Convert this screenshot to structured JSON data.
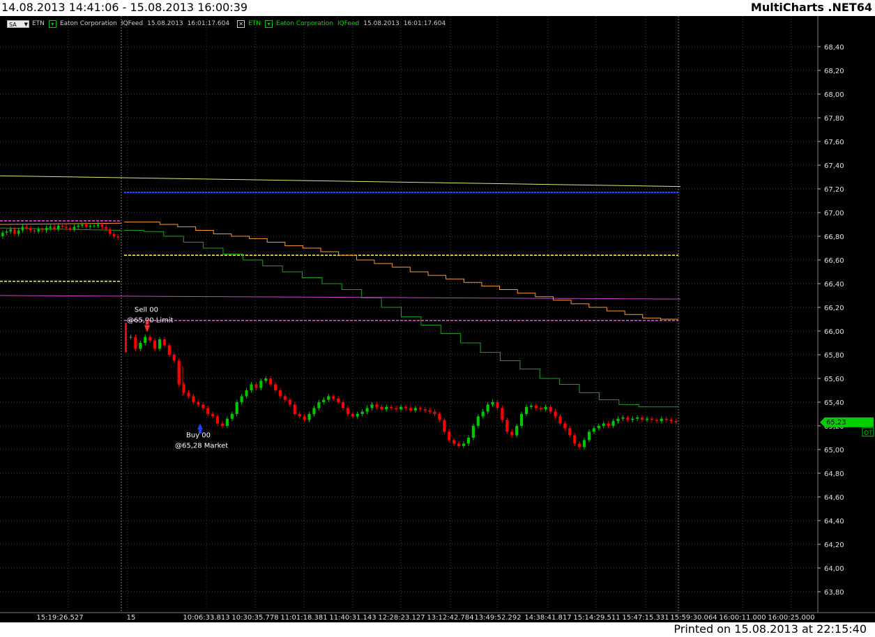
{
  "window": {
    "date_range": "14.08.2013 14:41:06 - 15.08.2013 16:00:39",
    "app_name": "MultiCharts .NET64",
    "printed": "Printed on 15.08.2013 at 22:15:40"
  },
  "legend": {
    "sa_label": "SA",
    "items1": [
      "ETN",
      "Eaton Corporation",
      "IQFeed",
      "15.08.2013",
      "16:01:17.604"
    ],
    "items2": [
      "ETN",
      "Eaton Corporation",
      "IQFeed",
      "15.08.2013",
      "16:01:17.604"
    ]
  },
  "chart_data": {
    "type": "candlestick",
    "symbol": "ETN",
    "ylim": [
      63.7,
      68.6
    ],
    "y_ticks": [
      "68,40",
      "68,20",
      "68,00",
      "67,80",
      "67,60",
      "67,40",
      "67,20",
      "67,00",
      "66,80",
      "66,60",
      "66,40",
      "66,20",
      "66,00",
      "65,80",
      "65,60",
      "65,40",
      "65,20",
      "65,00",
      "64,80",
      "64,60",
      "64,40",
      "64,20",
      "64,00",
      "63,80"
    ],
    "y_tick_values": [
      68.4,
      68.2,
      68.0,
      67.8,
      67.6,
      67.4,
      67.2,
      67.0,
      66.8,
      66.6,
      66.4,
      66.2,
      66.0,
      65.8,
      65.6,
      65.4,
      65.2,
      65.0,
      64.8,
      64.6,
      64.4,
      64.2,
      64.0,
      63.8
    ],
    "x_ticks": [
      "15:19:26.527",
      "15",
      "10:06:33.813",
      "10:30:35.778",
      "11:01:18.381",
      "11:40:31.143",
      "12:28:23.127",
      "13:12:42.784",
      "13:49:52.292",
      "14:38:41.817",
      "15:14:29.511",
      "15:47:15.331",
      "15:59:30.064",
      "16:00:11.000",
      "16:00:25.000"
    ],
    "last_price": "65,23",
    "last_badge": "OT",
    "colors": {
      "up": "#00c800",
      "down": "#ff0000",
      "price_tag": "#00d000"
    },
    "closes_day1": [
      66.83,
      66.84,
      66.86,
      66.82,
      66.85,
      66.88,
      66.87,
      66.85,
      66.84,
      66.86,
      66.85,
      66.87,
      66.88,
      66.86,
      66.89,
      66.88,
      66.87,
      66.86,
      66.88,
      66.89,
      66.9,
      66.88,
      66.89,
      66.89,
      66.9,
      66.88,
      66.86,
      66.82,
      66.8,
      66.79
    ],
    "closes_day2": [
      65.95,
      65.85,
      65.9,
      65.95,
      65.92,
      65.85,
      65.93,
      65.88,
      65.8,
      65.75,
      65.55,
      65.48,
      65.45,
      65.4,
      65.38,
      65.35,
      65.3,
      65.28,
      65.22,
      65.2,
      65.26,
      65.3,
      65.4,
      65.45,
      65.5,
      65.55,
      65.52,
      65.58,
      65.6,
      65.55,
      65.5,
      65.45,
      65.42,
      65.38,
      65.3,
      65.28,
      65.25,
      65.3,
      65.35,
      65.4,
      65.42,
      65.45,
      65.43,
      65.4,
      65.35,
      65.3,
      65.28,
      65.3,
      65.32,
      65.35,
      65.38,
      65.36,
      65.34,
      65.36,
      65.35,
      65.34,
      65.36,
      65.35,
      65.33,
      65.35,
      65.34,
      65.33,
      65.32,
      65.3,
      65.25,
      65.15,
      65.08,
      65.05,
      65.03,
      65.05,
      65.1,
      65.2,
      65.28,
      65.32,
      65.38,
      65.4,
      65.35,
      65.25,
      65.15,
      65.12,
      65.2,
      65.3,
      65.36,
      65.37,
      65.35,
      65.34,
      65.36,
      65.32,
      65.28,
      65.22,
      65.18,
      65.12,
      65.05,
      65.02,
      65.08,
      65.15,
      65.18,
      65.2,
      65.22,
      65.2,
      65.24,
      65.26,
      65.27,
      65.25,
      65.26,
      65.27,
      65.25,
      65.26,
      65.25,
      65.24,
      65.26,
      65.25,
      65.24,
      65.23
    ],
    "orders": [
      {
        "side": "Sell",
        "qty": "00",
        "text": "@65,90 Limit",
        "price": 65.9,
        "color": "#ff3030"
      },
      {
        "side": "Buy",
        "qty": "00",
        "text": "@65,28 Market",
        "price": 65.22,
        "color": "#2040ff"
      }
    ],
    "levels": {
      "yellow_top_start": 67.31,
      "yellow_top_end": 67.22,
      "blue_dashed": 67.17,
      "magenta_dashed_day1": 66.93,
      "magenta_dashed_day2": 66.09,
      "yellow_dashed_day2": 66.64,
      "yellow_dashed_day1": 66.42,
      "magenta_solid": 66.27
    },
    "orange_steps": [
      66.92,
      66.92,
      66.9,
      66.88,
      66.85,
      66.82,
      66.8,
      66.78,
      66.75,
      66.72,
      66.7,
      66.67,
      66.64,
      66.6,
      66.57,
      66.54,
      66.5,
      66.47,
      66.44,
      66.41,
      66.38,
      66.35,
      66.32,
      66.29,
      66.26,
      66.23,
      66.2,
      66.17,
      66.14,
      66.11,
      66.1
    ],
    "green_steps": [
      66.85,
      66.84,
      66.8,
      66.75,
      66.7,
      66.65,
      66.6,
      66.55,
      66.5,
      66.45,
      66.4,
      66.35,
      66.28,
      66.2,
      66.12,
      66.05,
      65.98,
      65.9,
      65.82,
      65.75,
      65.68,
      65.6,
      65.55,
      65.48,
      65.42,
      65.38,
      65.36,
      65.36
    ]
  }
}
